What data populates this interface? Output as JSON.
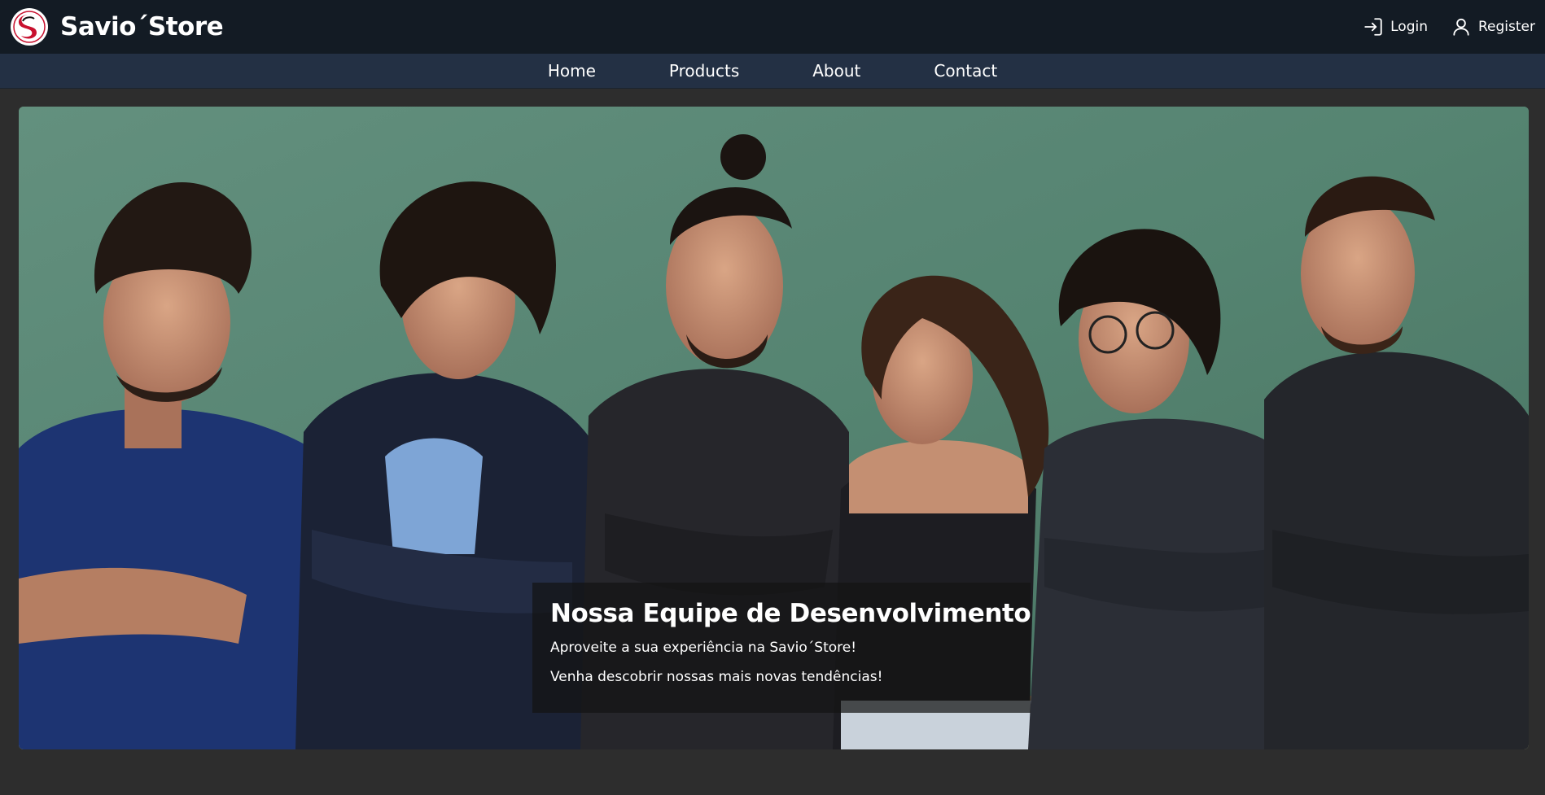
{
  "header": {
    "brand_name": "Savio´Store",
    "login_label": "Login",
    "register_label": "Register"
  },
  "nav": {
    "items": [
      {
        "label": "Home"
      },
      {
        "label": "Products"
      },
      {
        "label": "About"
      },
      {
        "label": "Contact"
      }
    ]
  },
  "hero": {
    "title": "Nossa Equipe de Desenvolvimento",
    "line1": "Aproveite a sua experiência na Savio´Store!",
    "line2": "Venha descobrir nossas mais novas tendências!"
  },
  "colors": {
    "header_bg": "#131b24",
    "nav_bg": "#233044",
    "page_bg": "#2d2d2d",
    "logo_red": "#c8102e"
  },
  "icons": {
    "logo": "brand-logo-icon",
    "login": "login-icon",
    "register": "user-icon"
  }
}
